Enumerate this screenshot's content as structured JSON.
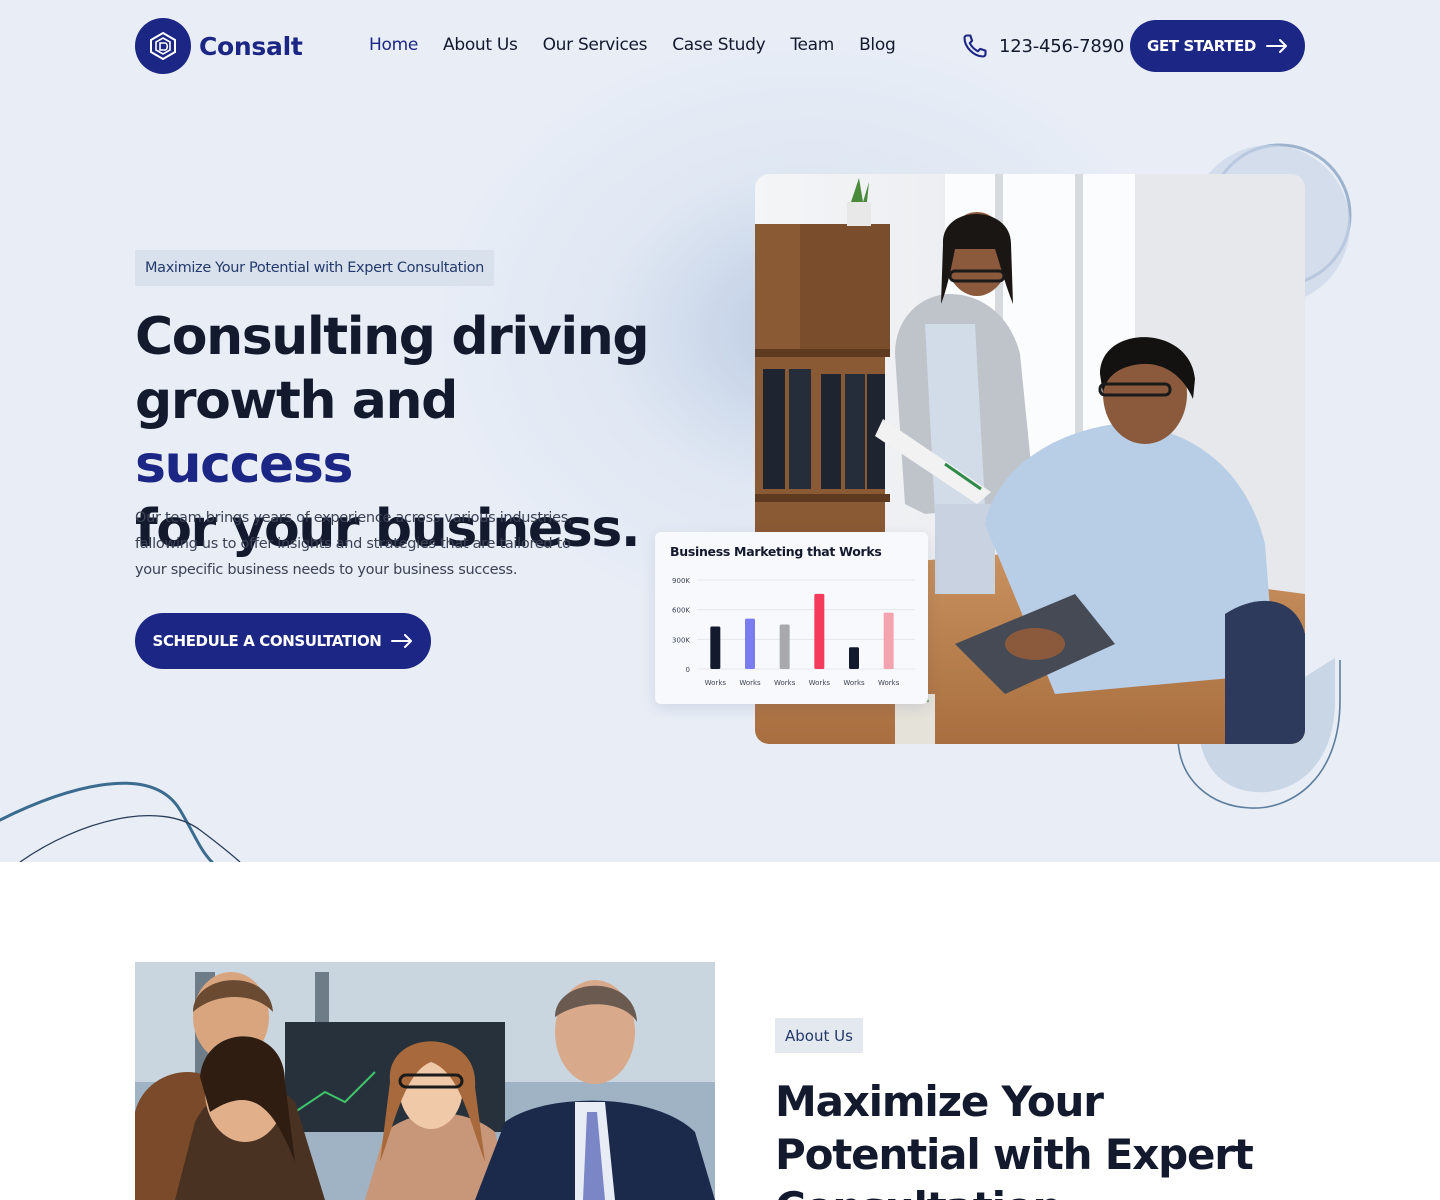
{
  "brand": {
    "name": "Consalt",
    "color": "#1c2685"
  },
  "nav": {
    "items": [
      {
        "label": "Home",
        "active": true
      },
      {
        "label": "About Us",
        "active": false
      },
      {
        "label": "Our Services",
        "active": false
      },
      {
        "label": "Case Study",
        "active": false
      },
      {
        "label": "Team",
        "active": false
      },
      {
        "label": "Blog",
        "active": false
      }
    ],
    "phone": "123-456-7890",
    "cta_label": "GET STARTED"
  },
  "hero": {
    "tag": "Maximize Your Potential with Expert Consultation",
    "headline_line1": "Consulting driving",
    "headline_line2_a": "growth and ",
    "headline_line2_accent": "success",
    "headline_line3": "for your business.",
    "description": "Our team brings years of experience across various industries, fallowing us to offer insights and strategies that are tailored to your specific business needs to your business success.",
    "cta_label": "SCHEDULE A CONSULTATION"
  },
  "chart_data": {
    "type": "bar",
    "title": "Business Marketing that Works",
    "categories": [
      "Works",
      "Works",
      "Works",
      "Works",
      "Works",
      "Works"
    ],
    "values": [
      430,
      510,
      450,
      760,
      220,
      570
    ],
    "colors": [
      "#141a2e",
      "#7b7cf0",
      "#a9a9ad",
      "#f43b5b",
      "#141a2e",
      "#f6a3b0"
    ],
    "ylim": [
      0,
      900
    ],
    "yticks": [
      0,
      300,
      600,
      900
    ],
    "ytick_labels": [
      "0",
      "300K",
      "600K",
      "900K"
    ],
    "xlabel": "",
    "ylabel": ""
  },
  "about": {
    "tag": "About Us",
    "title": "Maximize Your Potential with Expert Consultation."
  }
}
